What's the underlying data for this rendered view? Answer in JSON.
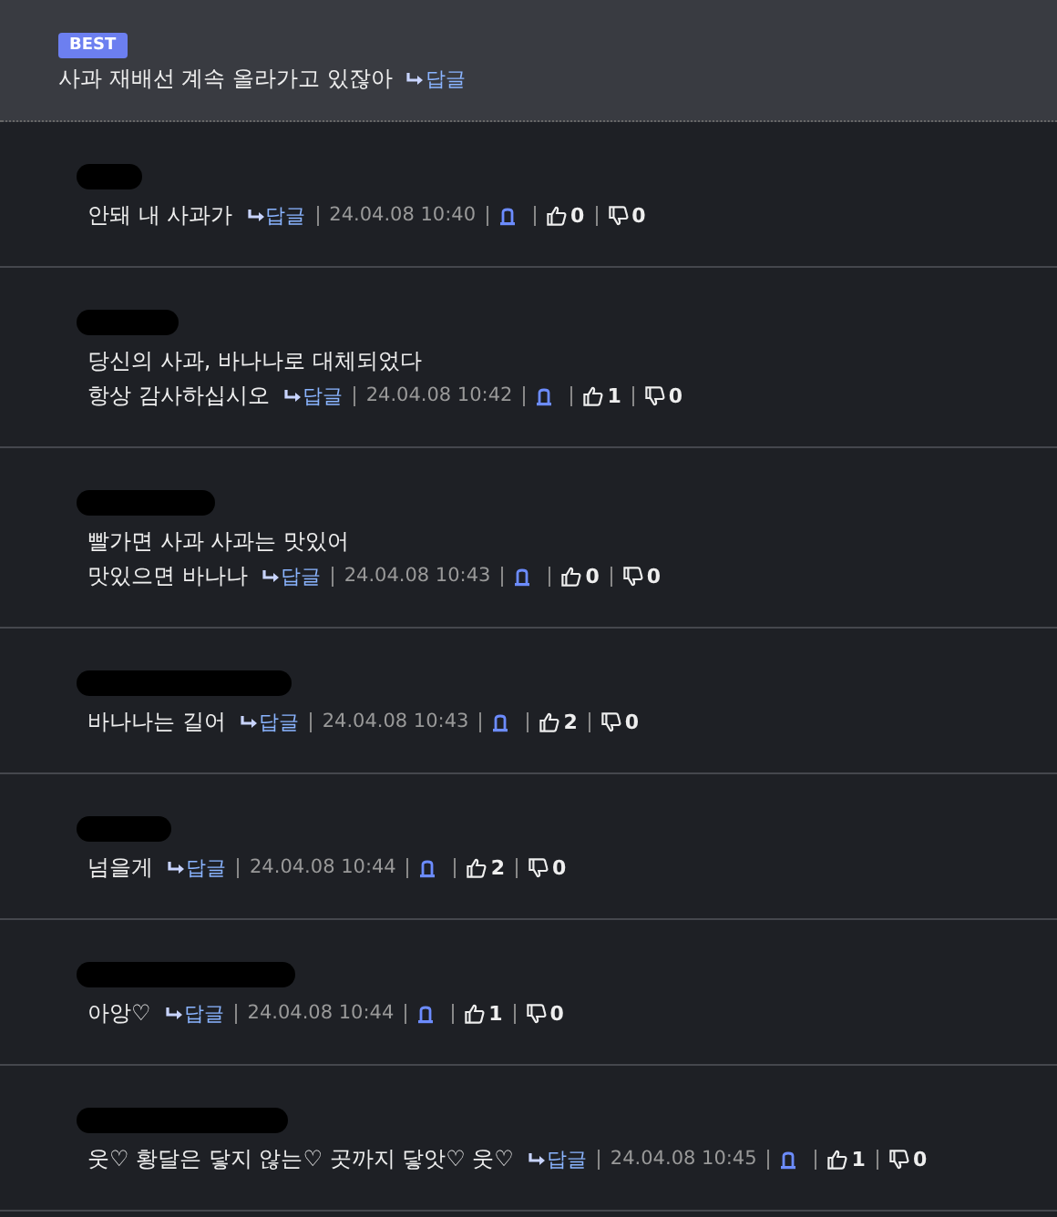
{
  "best": {
    "badge": "BEST",
    "text": "사과 재배선 계속 올라가고 있잖아",
    "reply": "답글"
  },
  "comments": [
    {
      "lines": [
        "안돼 내 사과가"
      ],
      "reply": "답글",
      "time": "24.04.08 10:40",
      "likes": "0",
      "dislikes": "0"
    },
    {
      "lines": [
        "당신의 사과, 바나나로 대체되었다",
        "항상 감사하십시오"
      ],
      "reply": "답글",
      "time": "24.04.08 10:42",
      "likes": "1",
      "dislikes": "0"
    },
    {
      "lines": [
        "빨가면 사과 사과는 맛있어",
        "맛있으면 바나나"
      ],
      "reply": "답글",
      "time": "24.04.08 10:43",
      "likes": "0",
      "dislikes": "0"
    },
    {
      "lines": [
        "바나나는 길어"
      ],
      "reply": "답글",
      "time": "24.04.08 10:43",
      "likes": "2",
      "dislikes": "0"
    },
    {
      "lines": [
        "넘을게"
      ],
      "reply": "답글",
      "time": "24.04.08 10:44",
      "likes": "2",
      "dislikes": "0"
    },
    {
      "lines": [
        "아앙♡"
      ],
      "reply": "답글",
      "time": "24.04.08 10:44",
      "likes": "1",
      "dislikes": "0"
    },
    {
      "lines": [
        "웃♡ 황달은 닿지 않는♡ 곳까지 닿앗♡ 웃♡"
      ],
      "reply": "답글",
      "time": "24.04.08 10:45",
      "likes": "1",
      "dislikes": "0"
    }
  ]
}
